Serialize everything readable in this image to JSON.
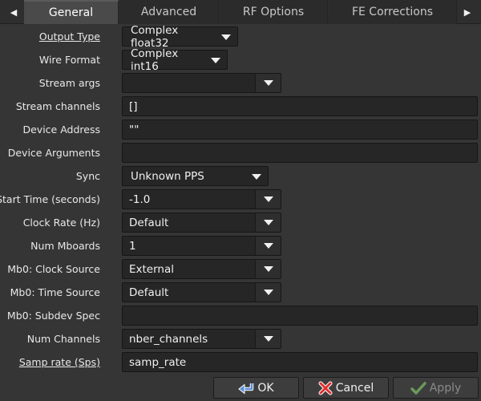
{
  "tabs": [
    {
      "label": "General",
      "active": true
    },
    {
      "label": "Advanced",
      "active": false
    },
    {
      "label": "RF Options",
      "active": false
    },
    {
      "label": "FE Corrections",
      "active": false
    }
  ],
  "fields": {
    "output_type": {
      "label": "Output Type",
      "value": "Complex float32"
    },
    "wire_format": {
      "label": "Wire Format",
      "value": "Complex int16"
    },
    "stream_args": {
      "label": "Stream args",
      "value": ""
    },
    "stream_channels": {
      "label": "Stream channels",
      "value": "[]"
    },
    "device_address": {
      "label": "Device Address",
      "value": "\"\""
    },
    "device_arguments": {
      "label": "Device Arguments",
      "value": ""
    },
    "sync": {
      "label": "Sync",
      "value": "Unknown PPS"
    },
    "start_time": {
      "label": "Start Time (seconds)",
      "value": "-1.0"
    },
    "clock_rate": {
      "label": "Clock Rate (Hz)",
      "value": "Default"
    },
    "num_mboards": {
      "label": "Num Mboards",
      "value": "1"
    },
    "mb0_clock_source": {
      "label": "Mb0: Clock Source",
      "value": "External"
    },
    "mb0_time_source": {
      "label": "Mb0: Time Source",
      "value": "Default"
    },
    "mb0_subdev_spec": {
      "label": "Mb0: Subdev Spec",
      "value": ""
    },
    "num_channels": {
      "label": "Num Channels",
      "value": "nber_channels"
    },
    "samp_rate": {
      "label": "Samp rate (Sps)",
      "value": "samp_rate"
    }
  },
  "buttons": {
    "ok": "OK",
    "cancel": "Cancel",
    "apply": "Apply"
  },
  "colors": {
    "background": "#353535",
    "field": "#262626",
    "ok_icon": "#5b8fd6",
    "cancel_icon": "#e03030",
    "apply_icon": "#6a9a5a"
  }
}
